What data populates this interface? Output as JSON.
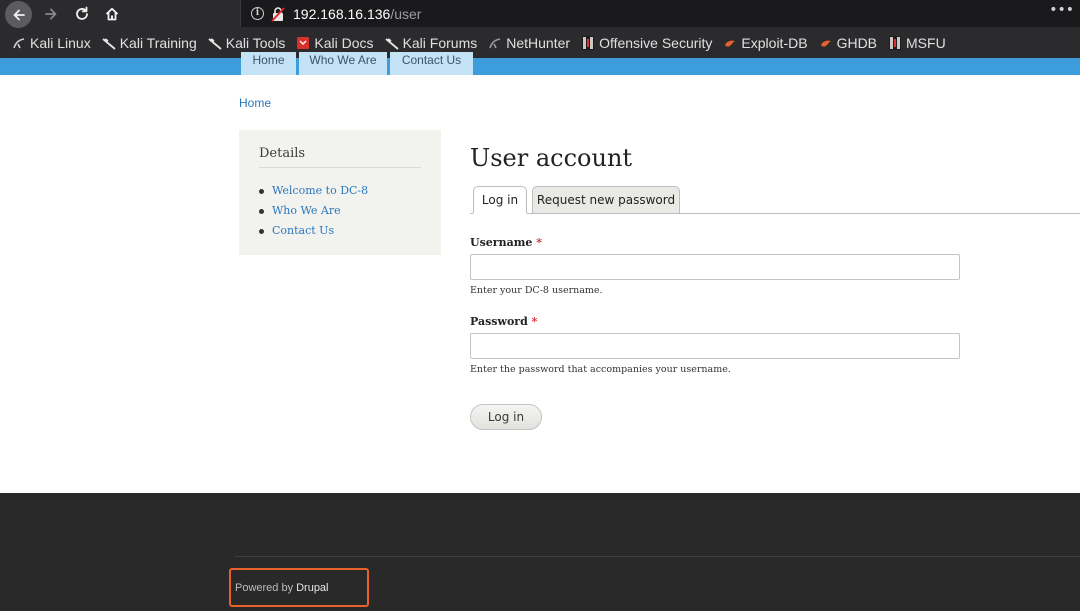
{
  "browser": {
    "url_host": "192.168.16.136",
    "url_path": "/user",
    "menu_label": "•••",
    "bookmarks": [
      {
        "label": "Kali Linux",
        "icon": "kali-dragon-icon"
      },
      {
        "label": "Kali Training",
        "icon": "kali-dragon-icon"
      },
      {
        "label": "Kali Tools",
        "icon": "kali-dragon-icon"
      },
      {
        "label": "Kali Docs",
        "icon": "kali-docs-icon"
      },
      {
        "label": "Kali Forums",
        "icon": "kali-dragon-icon"
      },
      {
        "label": "NetHunter",
        "icon": "nethunter-icon"
      },
      {
        "label": "Offensive Security",
        "icon": "offsec-icon"
      },
      {
        "label": "Exploit-DB",
        "icon": "exploitdb-icon"
      },
      {
        "label": "GHDB",
        "icon": "ghdb-icon"
      },
      {
        "label": "MSFU",
        "icon": "msfu-icon"
      }
    ]
  },
  "site_nav": {
    "items": [
      "Home",
      "Who We Are",
      "Contact Us"
    ]
  },
  "breadcrumb": "Home",
  "sidebar": {
    "title": "Details",
    "links": [
      "Welcome to DC-8",
      "Who We Are",
      "Contact Us"
    ]
  },
  "main": {
    "title": "User account",
    "tabs": [
      "Log in",
      "Request new password"
    ],
    "username": {
      "label": "Username",
      "required_mark": "*",
      "value": "",
      "description": "Enter your DC-8 username."
    },
    "password": {
      "label": "Password",
      "required_mark": "*",
      "value": "",
      "description": "Enter the password that accompanies your username."
    },
    "submit_label": "Log in"
  },
  "footer": {
    "powered_prefix": "Powered by",
    "powered_link": "Drupal"
  },
  "colors": {
    "accent_blue": "#3d9ddc",
    "link": "#2a77bf",
    "highlight_box": "#e8602c",
    "required": "#d12e2e"
  }
}
